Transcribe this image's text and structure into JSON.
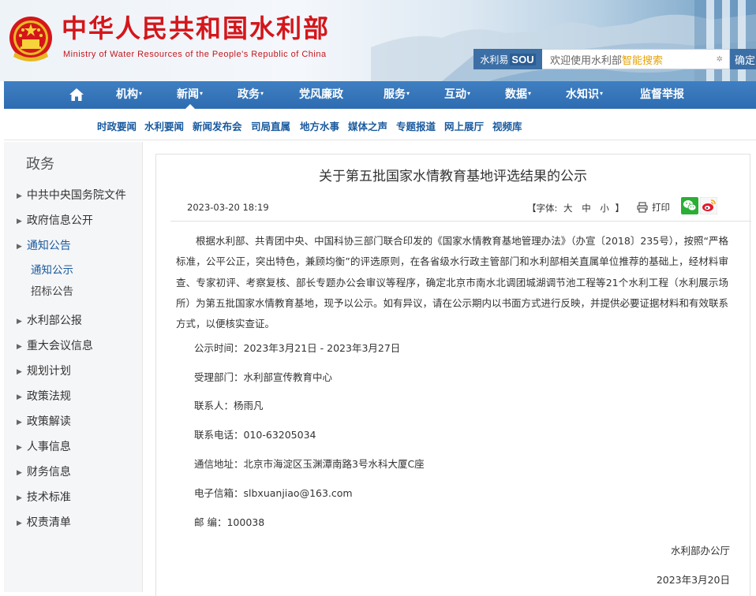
{
  "header": {
    "site_title": "中华人民共和国水利部",
    "site_subtitle": "Ministry of Water Resources of the People's Republic of China",
    "search_brand": "水利易",
    "search_brand_sou": "SOU",
    "search_placeholder_pre": "欢迎使用水利部",
    "search_placeholder_hl": "智能搜索",
    "search_button": "确定"
  },
  "nav": {
    "items": [
      {
        "label": "机构",
        "caret": "▾"
      },
      {
        "label": "新闻",
        "caret": "▾"
      },
      {
        "label": "政务",
        "caret": "▾"
      },
      {
        "label": "党风廉政",
        "caret": ""
      },
      {
        "label": "服务",
        "caret": "▾"
      },
      {
        "label": "互动",
        "caret": "▾"
      },
      {
        "label": "数据",
        "caret": "▾"
      },
      {
        "label": "水知识",
        "caret": "▾"
      },
      {
        "label": "监督举报",
        "caret": ""
      }
    ]
  },
  "subnav": {
    "items": [
      "时政要闻",
      "水利要闻",
      "新闻发布会",
      "司局直属",
      "地方水事",
      "媒体之声",
      "专题报道",
      "网上展厅",
      "视频库"
    ]
  },
  "sidebar": {
    "title": "政务",
    "items": [
      {
        "label": "中共中央国务院文件",
        "arrow": "▶"
      },
      {
        "label": "政府信息公开",
        "arrow": "▶"
      },
      {
        "label": "通知公告",
        "arrow": "▶"
      },
      {
        "label": "水利部公报",
        "arrow": "▶"
      },
      {
        "label": "重大会议信息",
        "arrow": "▶"
      },
      {
        "label": "规划计划",
        "arrow": "▶"
      },
      {
        "label": "政策法规",
        "arrow": "▶"
      },
      {
        "label": "政策解读",
        "arrow": "▶"
      },
      {
        "label": "人事信息",
        "arrow": "▶"
      },
      {
        "label": "财务信息",
        "arrow": "▶"
      },
      {
        "label": "技术标准",
        "arrow": "▶"
      },
      {
        "label": "权责清单",
        "arrow": "▶"
      }
    ],
    "sub_items": [
      "通知公示",
      "招标公告"
    ]
  },
  "article": {
    "title": "关于第五批国家水情教育基地评选结果的公示",
    "date": "2023-03-20 18:19",
    "font_label": "【字体:",
    "font_large": "大",
    "font_medium": "中",
    "font_small": "小",
    "font_close": "】",
    "print_label": "打印",
    "body": "根据水利部、共青团中央、中国科协三部门联合印发的《国家水情教育基地管理办法》（办宣〔2018〕235号），按照“严格标准，公平公正，突出特色，兼顾均衡”的评选原则，在各省级水行政主管部门和水利部相关直属单位推荐的基础上，经材料审查、专家初评、考察复核、部长专题办公会审议等程序，确定北京市南水北调团城湖调节池工程等21个水利工程（水利展示场所）为第五批国家水情教育基地，现予以公示。如有异议，请在公示期内以书面方式进行反映，并提供必要证据材料和有效联系方式，以便核实查证。",
    "lines": [
      "公示时间：2023年3月21日 - 2023年3月27日",
      "受理部门：水利部宣传教育中心",
      "联系人：杨雨凡",
      "联系电话：010-63205034",
      "通信地址：北京市海淀区玉渊潭南路3号水科大厦C座",
      "电子信箱：slbxuanjiao@163.com",
      "邮 编：100038"
    ],
    "sign_org": "水利部办公厅",
    "sign_date": "2023年3月20日"
  }
}
